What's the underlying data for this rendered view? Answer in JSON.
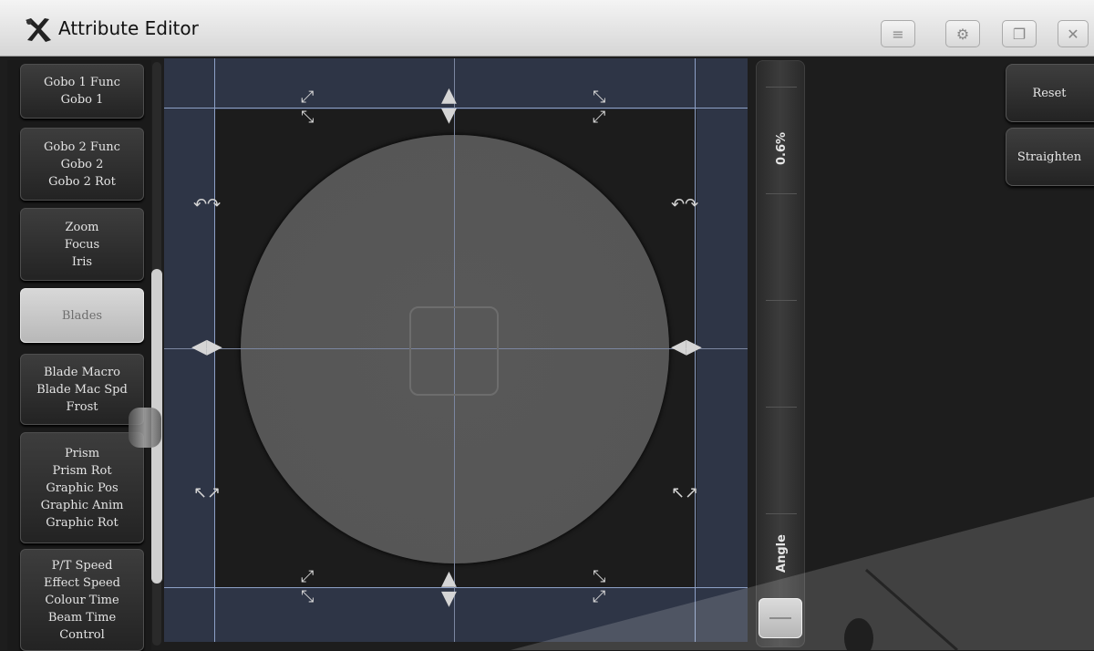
{
  "window": {
    "title": "Attribute Editor",
    "buttons": [
      {
        "name": "menu-button",
        "icon": "menu-icon",
        "glyph": "≡"
      },
      {
        "name": "settings-button",
        "icon": "gear-icon",
        "glyph": "⚙"
      },
      {
        "name": "restore-button",
        "icon": "window-icon",
        "glyph": "❐"
      },
      {
        "name": "close-button",
        "icon": "close-icon",
        "glyph": "✕"
      }
    ]
  },
  "sidebar": {
    "items": [
      {
        "lines": [
          "Gobo 1 Func",
          "Gobo 1"
        ]
      },
      {
        "lines": [
          "Gobo 2 Func",
          "Gobo 2",
          "Gobo 2 Rot"
        ]
      },
      {
        "lines": [
          "Zoom",
          "Focus",
          "Iris"
        ]
      },
      {
        "lines": [
          "Blades"
        ],
        "active": true
      },
      {
        "lines": [
          "Blade Macro",
          "Blade Mac Spd",
          "Frost"
        ]
      },
      {
        "lines": [
          "Prism",
          "Prism Rot",
          "Graphic Pos",
          "Graphic Anim",
          "Graphic Rot"
        ]
      },
      {
        "lines": [
          "P/T Speed",
          "Effect Speed",
          "Colour Time",
          "Beam Time",
          "Control"
        ]
      }
    ]
  },
  "slider": {
    "value": "0.6%",
    "label": "Angle"
  },
  "actions": {
    "reset_label": "Reset",
    "straighten_label": "Straighten"
  },
  "colors": {
    "accent_grid": "#8da0c6",
    "active_button": "#c8c8c8",
    "beam": "#575757"
  }
}
